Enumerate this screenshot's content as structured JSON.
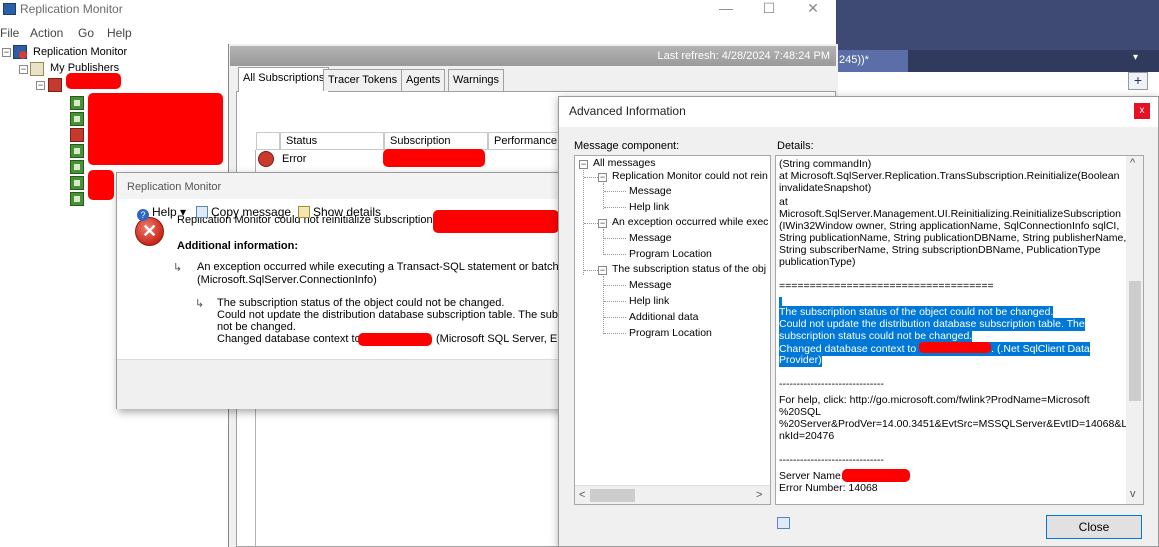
{
  "app": {
    "title": "Replication Monitor",
    "menu": [
      "File",
      "Action",
      "Go",
      "Help"
    ],
    "window_controls": [
      "—",
      "☐",
      "✕"
    ]
  },
  "background_editor": {
    "tab_label": "245))*",
    "down_glyph": "▾",
    "plus_glyph": "+"
  },
  "tree": {
    "root_label": "Replication Monitor",
    "publishers_label": "My Publishers",
    "expand_minus": "−"
  },
  "main_pane": {
    "last_refresh": "Last refresh: 4/28/2024 7:48:24 PM",
    "tabs": [
      "All Subscriptions",
      "Tracer Tokens",
      "Agents",
      "Warnings"
    ],
    "columns": [
      "Status",
      "Subscription",
      "Performance"
    ],
    "row_status": "Error"
  },
  "error_dialog": {
    "title": "Replication Monitor",
    "main_message": "Replication Monitor could not reinitialize subscription",
    "additional_info_label": "Additional information:",
    "arrow_glyph": "↳",
    "exception_line1": "An exception occurred while executing a Transact-SQL statement or batch.",
    "exception_line2": "(Microsoft.SqlServer.ConnectionInfo)",
    "inner_line1": "The subscription status of the object could not be changed.",
    "inner_line2": "Could not update the distribution database subscription table. The subsc",
    "inner_line3": "not be changed.",
    "inner_line4_pre": "Changed database context to",
    "inner_line4_post": "(Microsoft SQL Server, Er",
    "help_label": "Help",
    "help_caret": "▾",
    "copy_label": "Copy message",
    "details_label": "Show details"
  },
  "advanced_dialog": {
    "title": "Advanced Information",
    "close_x": "x",
    "message_component_label": "Message component:",
    "details_label": "Details:",
    "tree": {
      "root": "All messages",
      "group1": "Replication Monitor could not rein",
      "group1_items": [
        "Message",
        "Help link"
      ],
      "group2": "An exception occurred while exec",
      "group2_items": [
        "Message",
        "Program Location"
      ],
      "group3": "The subscription status of the obj",
      "group3_items": [
        "Message",
        "Help link",
        "Additional data",
        "Program Location"
      ]
    },
    "details": {
      "l01": "(String commandIn)",
      "l02": "   at Microsoft.SqlServer.Replication.TransSubscription.Reinitialize(Boolean",
      "l03": "invalidateSnapshot)",
      "l04": "   at",
      "l05": "Microsoft.SqlServer.Management.UI.Reinitializing.ReinitializeSubscription",
      "l06": "(IWin32Window owner, String applicationName, SqlConnectionInfo sqlCI,",
      "l07": "String publicationName, String publicationDBName, String publisherName,",
      "l08": "String subscriberName, String subscriptionDBName, PublicationType",
      "l09": "publicationType)",
      "l10": "===================================",
      "s1": "The subscription status of the object could not be changed.",
      "s2": "Could not update the distribution database subscription table. The",
      "s3": "subscription status could not be changed.",
      "s4_pre": "Changed database context to",
      "s4_post": ". (.Net SqlClient Data",
      "s5": "Provider)",
      "l11": "------------------------------",
      "l12": "For help, click: http://go.microsoft.com/fwlink?ProdName=Microsoft",
      "l13": "%20SQL",
      "l14": "%20Server&ProdVer=14.00.3451&EvtSrc=MSSQLServer&EvtID=14068&Li",
      "l15": "nkId=20476",
      "l16": "------------------------------",
      "l17": "Server Name:",
      "l18": "Error Number: 14068"
    },
    "close_button": "Close",
    "scroll_up": "^",
    "scroll_down": "v",
    "scroll_left": "<",
    "scroll_right": ">"
  }
}
